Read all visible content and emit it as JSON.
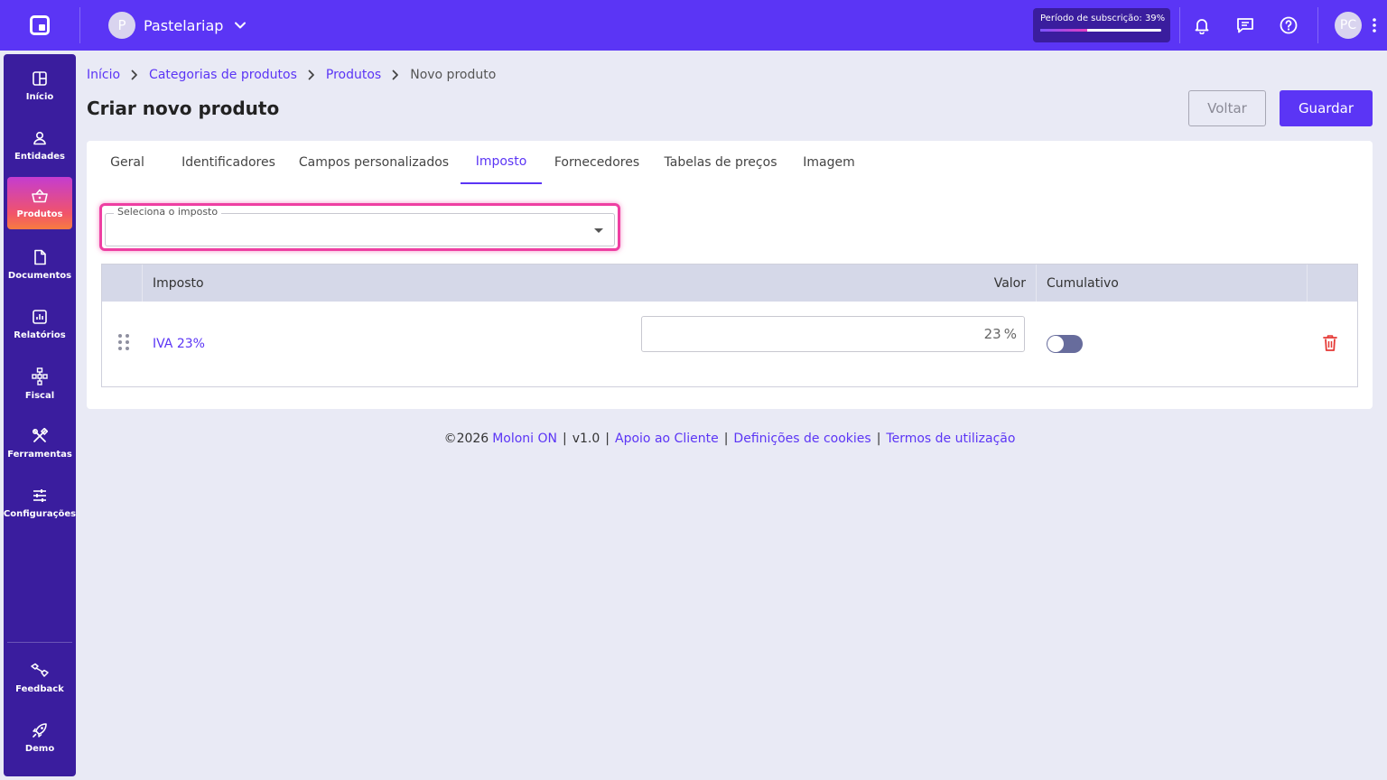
{
  "topbar": {
    "company_initial": "P",
    "company_name": "Pastelariap",
    "subscription_label": "Período de subscrição: 39%",
    "subscription_progress": 0.39,
    "user_initials": "PC"
  },
  "sidebar": {
    "items": [
      {
        "label": "Início",
        "icon": "dashboard-icon"
      },
      {
        "label": "Entidades",
        "icon": "user-icon"
      },
      {
        "label": "Produtos",
        "icon": "basket-icon",
        "active": true
      },
      {
        "label": "Documentos",
        "icon": "document-icon"
      },
      {
        "label": "Relatórios",
        "icon": "report-icon"
      },
      {
        "label": "Fiscal",
        "icon": "hierarchy-icon"
      },
      {
        "label": "Ferramentas",
        "icon": "tools-icon"
      },
      {
        "label": "Configurações",
        "icon": "sliders-icon"
      }
    ],
    "bottom": [
      {
        "label": "Feedback",
        "icon": "feedback-icon"
      },
      {
        "label": "Demo",
        "icon": "rocket-icon"
      }
    ]
  },
  "breadcrumb": {
    "items": [
      "Início",
      "Categorias de produtos",
      "Produtos"
    ],
    "current": "Novo produto"
  },
  "page": {
    "title": "Criar novo produto",
    "back_label": "Voltar",
    "save_label": "Guardar"
  },
  "tabs": [
    {
      "label": "Geral"
    },
    {
      "label": "Identificadores"
    },
    {
      "label": "Campos personalizados"
    },
    {
      "label": "Imposto",
      "active": true
    },
    {
      "label": "Fornecedores"
    },
    {
      "label": "Tabelas de preços"
    },
    {
      "label": "Imagem"
    }
  ],
  "tax_select": {
    "label": "Seleciona o imposto",
    "value": ""
  },
  "tax_table": {
    "columns": [
      "Imposto",
      "Valor",
      "Cumulativo"
    ],
    "rows": [
      {
        "name": "IVA 23%",
        "value": "23",
        "suffix": "%",
        "cumulative": false
      }
    ]
  },
  "footer": {
    "copyright": "©2026",
    "brand": "Moloni ON",
    "version": "v1.0",
    "support": "Apoio ao Cliente",
    "cookies": "Definições de cookies",
    "terms": "Termos de utilização",
    "separator": "|"
  },
  "colors": {
    "primary": "#5b35f5",
    "sidebar": "#3a1d9e",
    "highlight": "#ee3fa2",
    "delete": "#e53935"
  }
}
